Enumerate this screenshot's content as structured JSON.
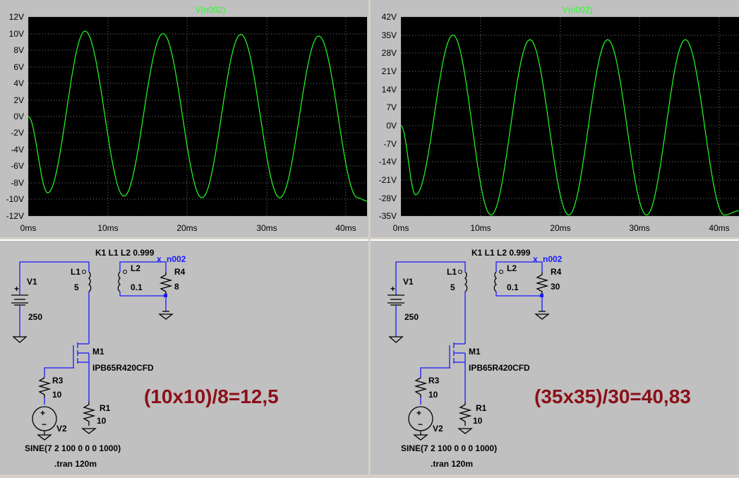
{
  "plots": [
    {
      "trace_name": "V(n002)",
      "y_ticks": [
        "12V",
        "10V",
        "8V",
        "6V",
        "4V",
        "2V",
        "0V",
        "-2V",
        "-4V",
        "-6V",
        "-8V",
        "-10V",
        "-12V"
      ],
      "x_ticks": [
        "0ms",
        "10ms",
        "20ms",
        "30ms",
        "40ms"
      ],
      "trace_color": "#22ff22"
    },
    {
      "trace_name": "V(n002)",
      "y_ticks": [
        "42V",
        "35V",
        "28V",
        "21V",
        "14V",
        "7V",
        "0V",
        "-7V",
        "-14V",
        "-21V",
        "-28V",
        "-35V"
      ],
      "x_ticks": [
        "0ms",
        "10ms",
        "20ms",
        "30ms",
        "40ms"
      ],
      "trace_color": "#22ff22"
    }
  ],
  "chart_data": [
    {
      "type": "line",
      "title": "V(n002)",
      "x": [
        0,
        2.5,
        7.3,
        12.3,
        17.3,
        22.3,
        27.3,
        32.3,
        37.3,
        42.3,
        43.5
      ],
      "y": [
        0,
        -9.2,
        10.3,
        -9.6,
        10.0,
        -9.8,
        9.9,
        -9.8,
        9.7,
        -9.8,
        -10.2
      ],
      "xlim": [
        0,
        43.5
      ],
      "ylim": [
        -12,
        12
      ],
      "x_unit": "ms",
      "y_unit": "V"
    },
    {
      "type": "line",
      "title": "V(n002)",
      "x": [
        0,
        1.9,
        6.7,
        11.6,
        16.6,
        21.6,
        26.6,
        31.6,
        36.6,
        41.6,
        43.5
      ],
      "y": [
        0,
        -26.8,
        35.0,
        -34.6,
        33.2,
        -34.6,
        33.2,
        -34.6,
        33.2,
        -34.6,
        -33
      ],
      "xlim": [
        0,
        43.5
      ],
      "ylim": [
        -35,
        42
      ],
      "x_unit": "ms",
      "y_unit": "V"
    }
  ],
  "schematics": [
    {
      "coupling": "K1 L1 L2 0.999",
      "v1_name": "V1",
      "v1_value": "250",
      "l1_name": "L1",
      "l1_value": "5",
      "l2_name": "L2",
      "l2_value": "0.1",
      "net_label": "n002",
      "r4_name": "R4",
      "r4_value": "8",
      "m1_name": "M1",
      "m1_model": "IPB65R420CFD",
      "r3_name": "R3",
      "r3_value": "10",
      "r1_name": "R1",
      "r1_value": "10",
      "v2_name": "V2",
      "v2_value": "SINE(7 2 100 0 0 0 1000)",
      "directive": ".tran 120m",
      "calc": "(10x10)/8=12,5"
    },
    {
      "coupling": "K1 L1 L2 0.999",
      "v1_name": "V1",
      "v1_value": "250",
      "l1_name": "L1",
      "l1_value": "5",
      "l2_name": "L2",
      "l2_value": "0.1",
      "net_label": "n002",
      "r4_name": "R4",
      "r4_value": "30",
      "m1_name": "M1",
      "m1_model": "IPB65R420CFD",
      "r3_name": "R3",
      "r3_value": "10",
      "r1_name": "R1",
      "r1_value": "10",
      "v2_name": "V2",
      "v2_value": "SINE(7 2 100 0 0 0 1000)",
      "directive": ".tran 120m",
      "calc": "(35x35)/30=40,83"
    }
  ]
}
